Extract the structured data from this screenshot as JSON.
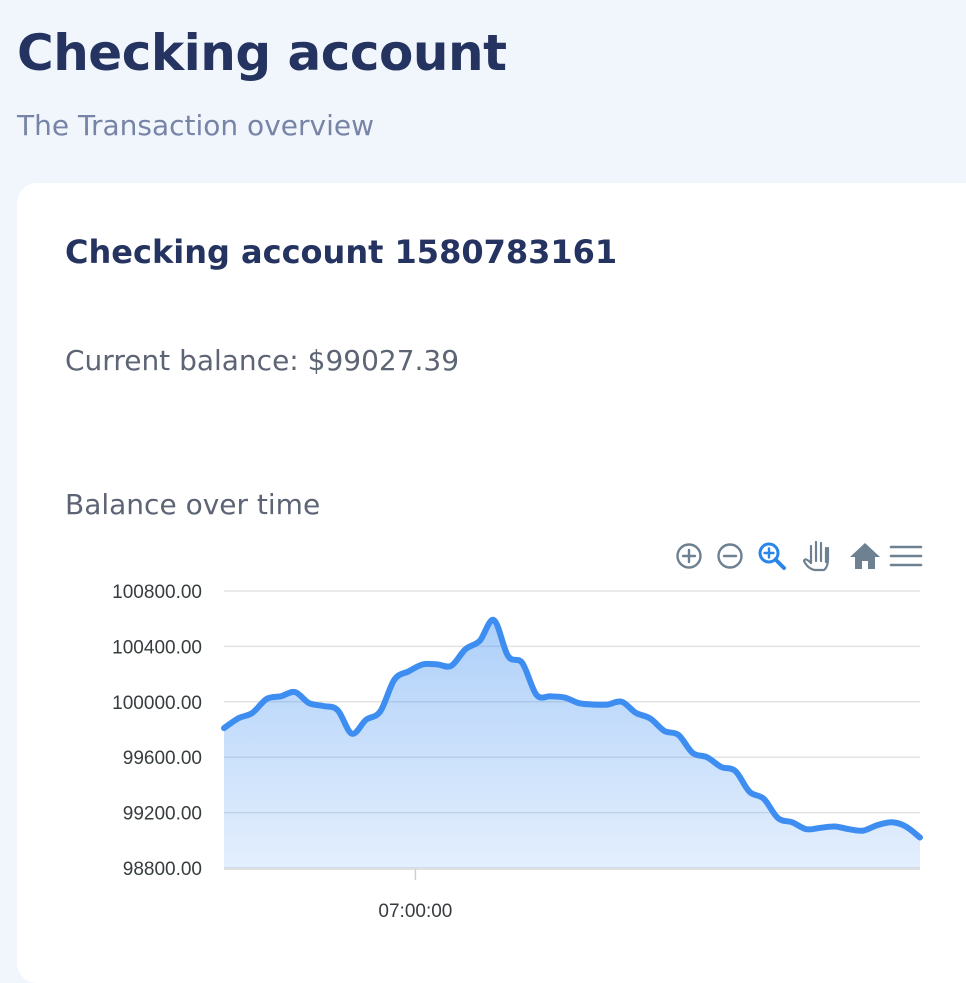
{
  "header": {
    "title": "Checking account",
    "subtitle": "The Transaction overview"
  },
  "account": {
    "title": "Checking account 1580783161",
    "balance_text": "Current balance: $99027.39"
  },
  "chart_section": {
    "heading": "Balance over time"
  },
  "toolbar": {
    "icons": [
      "zoom-in-icon",
      "zoom-out-icon",
      "zoom-selection-icon",
      "pan-icon",
      "reset-home-icon",
      "menu-icon"
    ],
    "active_icon": "zoom-selection-icon"
  },
  "colors": {
    "series": "#3e8ef1",
    "title": "#24335f",
    "background": "#f1f6fd",
    "active_tool": "#2a86e8",
    "inactive_tool": "#6e8192"
  },
  "chart_data": {
    "type": "area",
    "title": "",
    "xlabel": "",
    "ylabel": "",
    "ylim": [
      98800,
      100800
    ],
    "y_ticks": [
      100800,
      100400,
      100000,
      99600,
      99200,
      98800
    ],
    "y_tick_labels": [
      "100800.00",
      "100400.00",
      "100000.00",
      "99600.00",
      "99200.00",
      "98800.00"
    ],
    "x_tick_labels": [
      "07:00:00"
    ],
    "x_tick_position": 0.275,
    "grid": true,
    "legend": "none",
    "series": [
      {
        "values": [
          99810,
          99880,
          99920,
          100020,
          100040,
          100070,
          99990,
          99970,
          99940,
          99770,
          99870,
          99930,
          100160,
          100220,
          100270,
          100270,
          100260,
          100380,
          100440,
          100590,
          100330,
          100280,
          100050,
          100040,
          100030,
          99990,
          99980,
          99980,
          100000,
          99920,
          99880,
          99790,
          99760,
          99630,
          99600,
          99530,
          99500,
          99350,
          99300,
          99160,
          99130,
          99080,
          99090,
          99100,
          99080,
          99070,
          99110,
          99130,
          99100,
          99020
        ]
      }
    ]
  }
}
